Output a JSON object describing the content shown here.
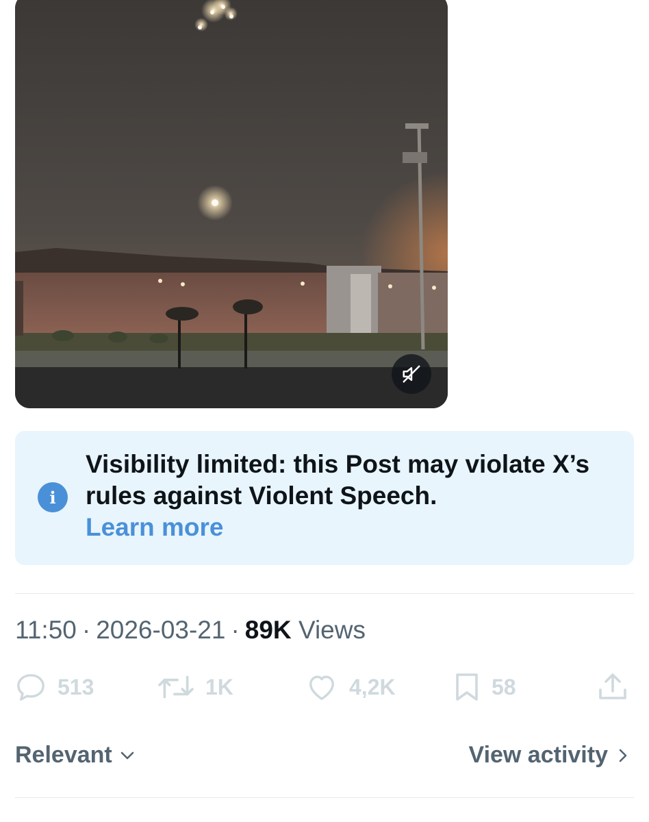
{
  "media": {
    "mute_icon": "volume-muted-icon"
  },
  "notice": {
    "icon": "info-icon",
    "icon_glyph": "i",
    "text": "Visibility limited: this Post may violate X’s rules against Violent Speech.",
    "link": "Learn more",
    "background": "#e8f5fd",
    "accent": "#4a90d9"
  },
  "meta": {
    "time": "11:50",
    "separator": "·",
    "date": "2026-03-21",
    "views_count": "89K",
    "views_label": "Views"
  },
  "actions": {
    "replies": {
      "icon": "reply-icon",
      "count": "513"
    },
    "reposts": {
      "icon": "repost-icon",
      "count": "1K"
    },
    "likes": {
      "icon": "heart-icon",
      "count": "4,2K"
    },
    "bookmarks": {
      "icon": "bookmark-icon",
      "count": "58"
    },
    "share": {
      "icon": "share-icon"
    }
  },
  "footer": {
    "sort_label": "Relevant",
    "activity_label": "View activity"
  }
}
